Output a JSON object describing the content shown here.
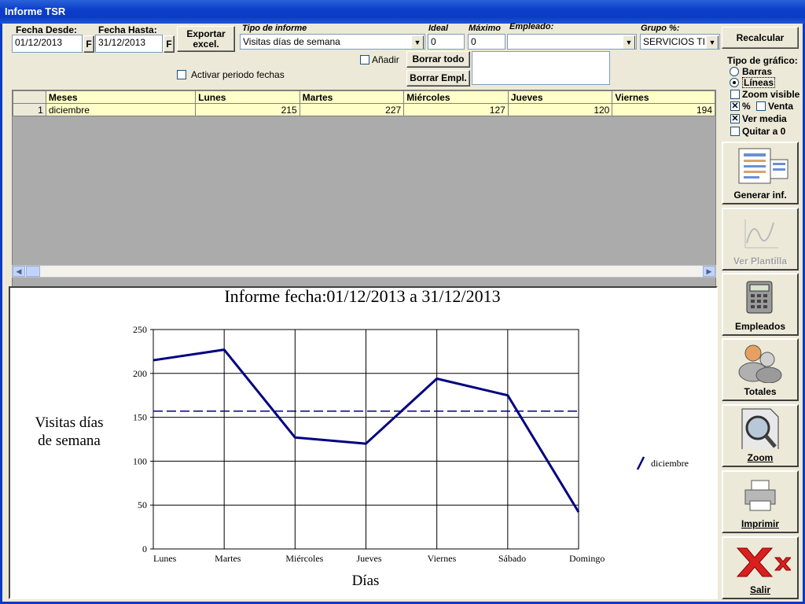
{
  "window": {
    "title": "Informe TSR"
  },
  "filters": {
    "fecha_desde_label": "Fecha Desde:",
    "fecha_desde_value": "01/12/2013",
    "fecha_hasta_label": "Fecha Hasta:",
    "fecha_hasta_value": "31/12/2013",
    "f_button": "F",
    "exportar_label": "Exportar excel.",
    "tipo_label": "Tipo de informe",
    "tipo_value": "Visitas días de semana",
    "ideal_label": "Ideal",
    "ideal_value": "0",
    "maximo_label": "Máximo",
    "maximo_value": "0",
    "empleado_label": "Empleado:",
    "empleado_value": "",
    "grupo_label": "Grupo %:",
    "grupo_value": "SERVICIOS TI",
    "anadir_label": "Añadir",
    "borrar_todo_label": "Borrar todo",
    "borrar_empl_label": "Borrar Empl.",
    "activar_label": "Activar periodo fechas"
  },
  "grid": {
    "headers": [
      "Meses",
      "Lunes",
      "Martes",
      "Miércoles",
      "Jueves",
      "Viernes"
    ],
    "rows": [
      {
        "n": "1",
        "cells": [
          "diciembre",
          "215",
          "227",
          "127",
          "120",
          "194"
        ]
      }
    ]
  },
  "options": {
    "recalcular_label": "Recalcular",
    "tipo_grafico_label": "Tipo de gráfico:",
    "barras_label": "Barras",
    "lineas_label": "Líneas",
    "zoom_visible_label": "Zoom visible",
    "pct_label": "%",
    "venta_label": "Venta",
    "ver_media_label": "Ver media",
    "quitar_label": "Quitar a 0",
    "barras_checked": false,
    "lineas_checked": true,
    "zoom_visible_checked": false,
    "pct_checked": true,
    "venta_checked": false,
    "ver_media_checked": true,
    "quitar_checked": false
  },
  "side": {
    "generar_label": "Generar inf.",
    "ver_plantilla_label": "Ver Plantilla",
    "empleados_label": "Empleados",
    "totales_label": "Totales",
    "zoom_label": "Zoom",
    "imprimir_label": "Imprimir",
    "salir_label": "Salir"
  },
  "chart_data": {
    "type": "line",
    "title": "Informe fecha:01/12/2013 a 31/12/2013",
    "xlabel": "Días",
    "ylabel": "Visitas días de semana",
    "categories": [
      "Lunes",
      "Martes",
      "Miércoles",
      "Jueves",
      "Viernes",
      "Sábado",
      "Domingo"
    ],
    "series": [
      {
        "name": "diciembre",
        "values": [
          215,
          227,
          127,
          120,
          194,
          175,
          42
        ],
        "color": "#000080"
      }
    ],
    "mean_line": 157,
    "ylim": [
      0,
      250
    ],
    "yticks": [
      0,
      50,
      100,
      150,
      200,
      250
    ],
    "grid": true,
    "legend": "right"
  }
}
